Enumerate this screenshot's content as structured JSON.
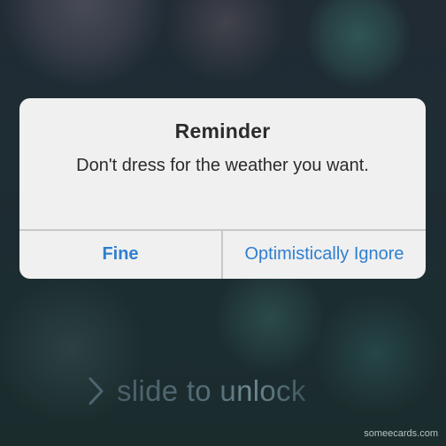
{
  "alert": {
    "title": "Reminder",
    "message": "Don't dress for the weather you want.",
    "buttons": {
      "primary": "Fine",
      "secondary": "Optimistically Ignore"
    }
  },
  "lock_screen": {
    "slider_label": "slide to unlock",
    "slider_icon": "chevron-right-icon"
  },
  "watermark": "someecards.com",
  "colors": {
    "button_text": "#2f7fcf",
    "alert_background": "#f0f0f0",
    "title_text": "#2b2b2b",
    "divider": "#c8c8c8"
  }
}
